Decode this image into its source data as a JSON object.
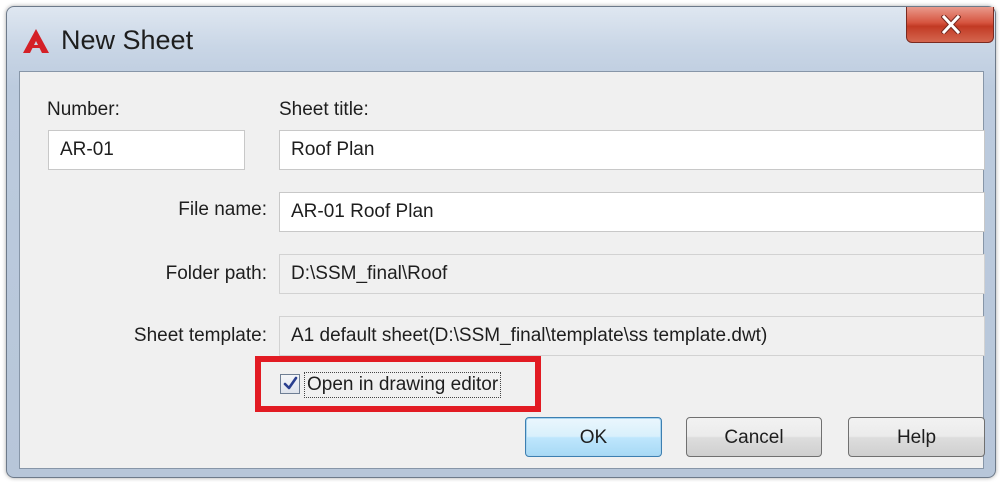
{
  "window": {
    "title": "New Sheet",
    "close_label": "X"
  },
  "fields": {
    "number": {
      "label": "Number:",
      "value": "AR-01"
    },
    "sheet_title": {
      "label": "Sheet title:",
      "value": "Roof Plan"
    },
    "file_name": {
      "label": "File name:",
      "value": "AR-01 Roof Plan"
    },
    "folder_path": {
      "label": "Folder path:",
      "value": "D:\\SSM_final\\Roof"
    },
    "sheet_template": {
      "label": "Sheet template:",
      "value": "A1 default sheet(D:\\SSM_final\\template\\ss template.dwt)"
    }
  },
  "checkbox": {
    "label": "Open in drawing editor",
    "checked": true
  },
  "buttons": {
    "ok": "OK",
    "cancel": "Cancel",
    "help": "Help"
  },
  "colors": {
    "highlight": "#e21b23",
    "app_icon": "#d42027"
  }
}
